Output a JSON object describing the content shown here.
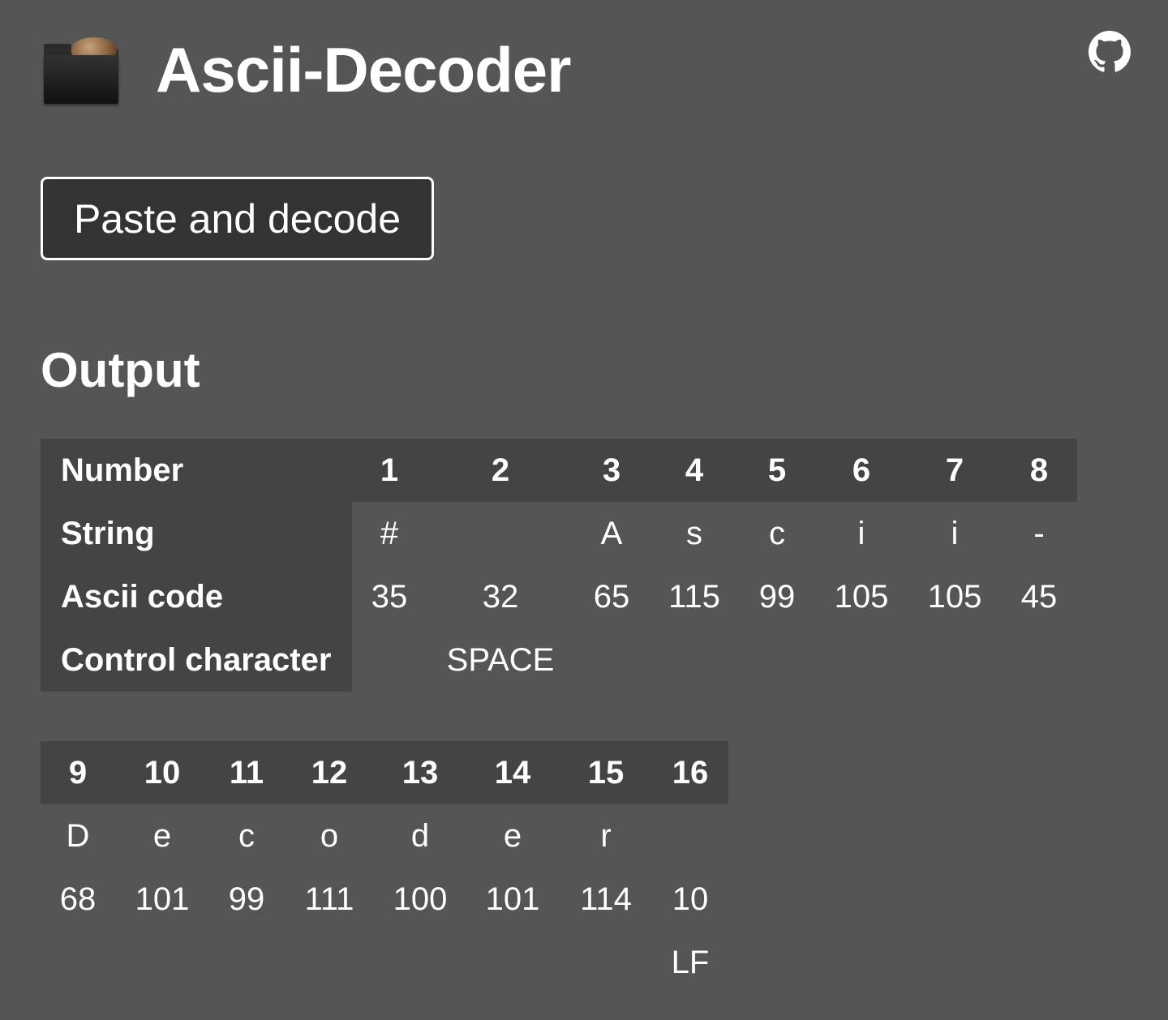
{
  "header": {
    "title": "Ascii-Decoder",
    "logo_icon": "brain-in-folder-icon",
    "github_icon": "github-icon"
  },
  "paste_button": {
    "label": "Paste and decode"
  },
  "output": {
    "heading": "Output",
    "row_labels": {
      "number": "Number",
      "string": "String",
      "ascii_code": "Ascii code",
      "control_character": "Control character"
    },
    "table1": {
      "numbers": [
        "1",
        "2",
        "3",
        "4",
        "5",
        "6",
        "7",
        "8"
      ],
      "strings": [
        "#",
        "",
        "A",
        "s",
        "c",
        "i",
        "i",
        "-"
      ],
      "codes": [
        "35",
        "32",
        "65",
        "115",
        "99",
        "105",
        "105",
        "45"
      ],
      "controls": [
        "",
        "SPACE",
        "",
        "",
        "",
        "",
        "",
        ""
      ]
    },
    "table2": {
      "numbers": [
        "9",
        "10",
        "11",
        "12",
        "13",
        "14",
        "15",
        "16"
      ],
      "strings": [
        "D",
        "e",
        "c",
        "o",
        "d",
        "e",
        "r",
        ""
      ],
      "codes": [
        "68",
        "101",
        "99",
        "111",
        "100",
        "101",
        "114",
        "10"
      ],
      "controls": [
        "",
        "",
        "",
        "",
        "",
        "",
        "",
        "LF"
      ]
    }
  },
  "colors": {
    "background": "#555555",
    "header_cell": "#444444",
    "button": "#333333",
    "text": "#ffffff"
  }
}
